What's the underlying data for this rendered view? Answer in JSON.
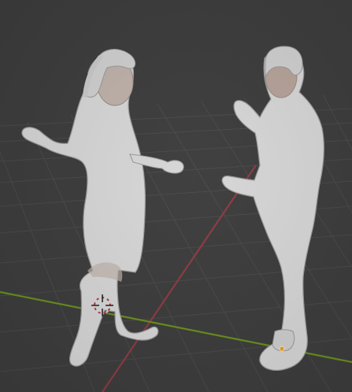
{
  "viewport": {
    "background_color": "#3d3d3d",
    "grid_line_color": "#4a4a4a",
    "x_axis_color": "#8f3b43",
    "y_axis_color": "#6a8f1d",
    "figure_base_color": "#d7d7d7",
    "figure_shadow_color": "#8f8f8f",
    "skin_tone": "#b7a49b",
    "cursor_color": "#d7d7d7",
    "cursor_alt_color": "#b23b3b",
    "origin_marker_color": "#f3a11b"
  },
  "objects": [
    {
      "name": "female-character",
      "type": "mesh"
    },
    {
      "name": "male-character",
      "type": "mesh"
    }
  ],
  "overlays": {
    "three_d_cursor_icon": "3d-cursor-icon",
    "origin_marker_icon": "origin-dot-icon"
  }
}
